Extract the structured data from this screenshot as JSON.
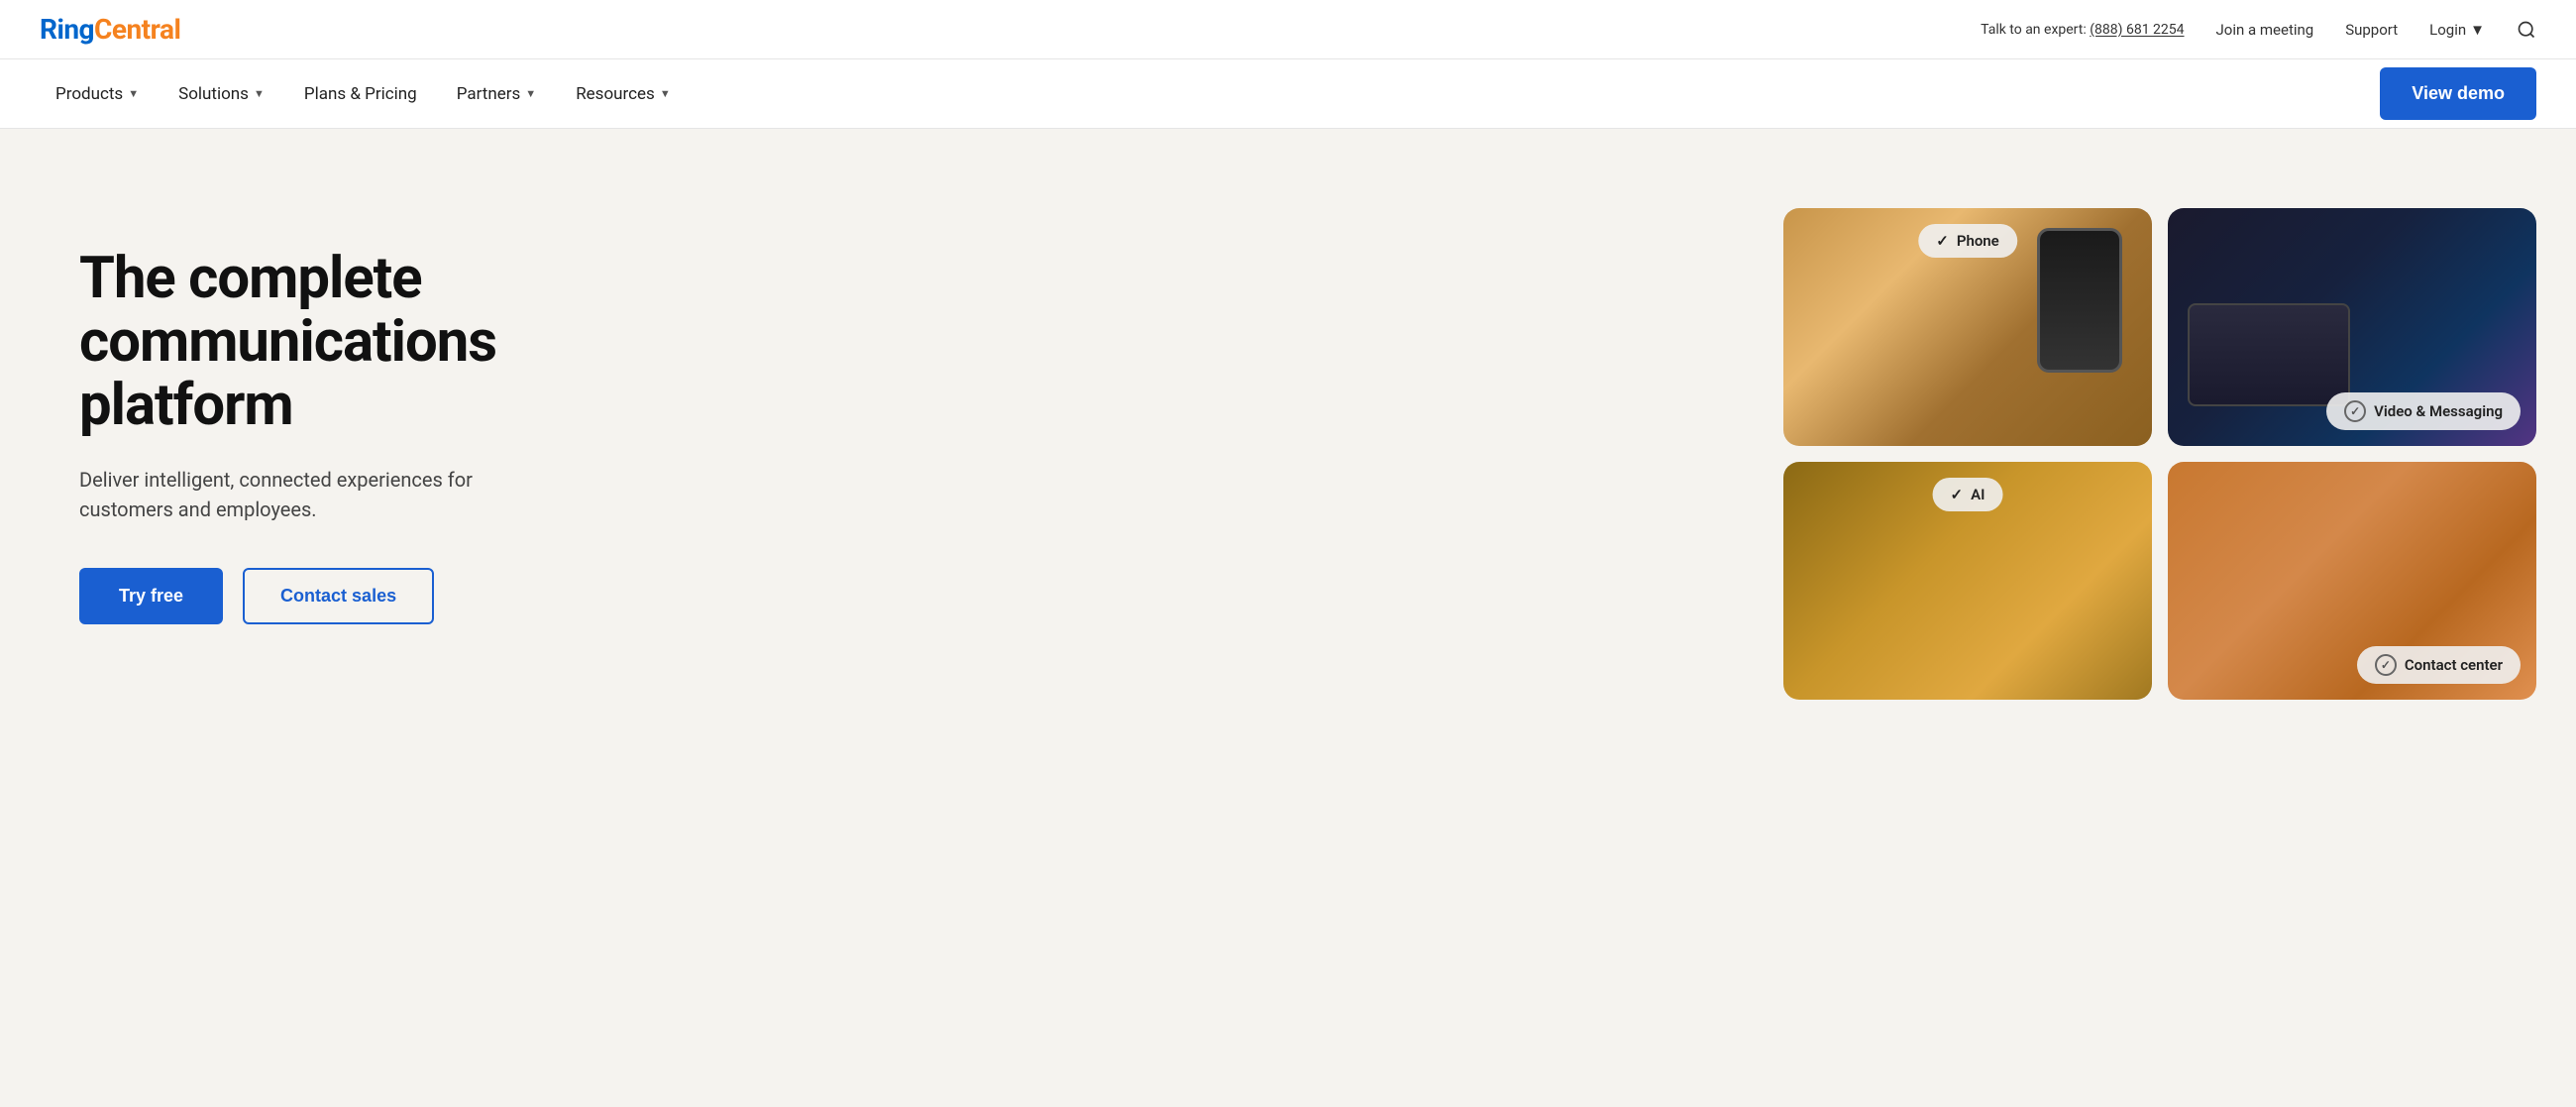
{
  "topbar": {
    "logo_ring": "Ring",
    "logo_central": "Central",
    "expert_label": "Talk to an expert:",
    "expert_phone": "(888) 681 2254",
    "join_meeting": "Join a meeting",
    "support": "Support",
    "login": "Login"
  },
  "nav": {
    "products": "Products",
    "solutions": "Solutions",
    "plans_pricing": "Plans & Pricing",
    "partners": "Partners",
    "resources": "Resources",
    "view_demo": "View demo"
  },
  "hero": {
    "title_line1": "The complete",
    "title_line2": "communications platform",
    "subtitle": "Deliver intelligent, connected experiences for customers and employees.",
    "try_free": "Try free",
    "contact_sales": "Contact sales",
    "cards": [
      {
        "id": "phone",
        "label": "Phone",
        "position": "top"
      },
      {
        "id": "video",
        "label": "Video & Messaging",
        "position": "bottom"
      },
      {
        "id": "ai",
        "label": "AI",
        "position": "top"
      },
      {
        "id": "contact",
        "label": "Contact center",
        "position": "bottom"
      }
    ]
  }
}
